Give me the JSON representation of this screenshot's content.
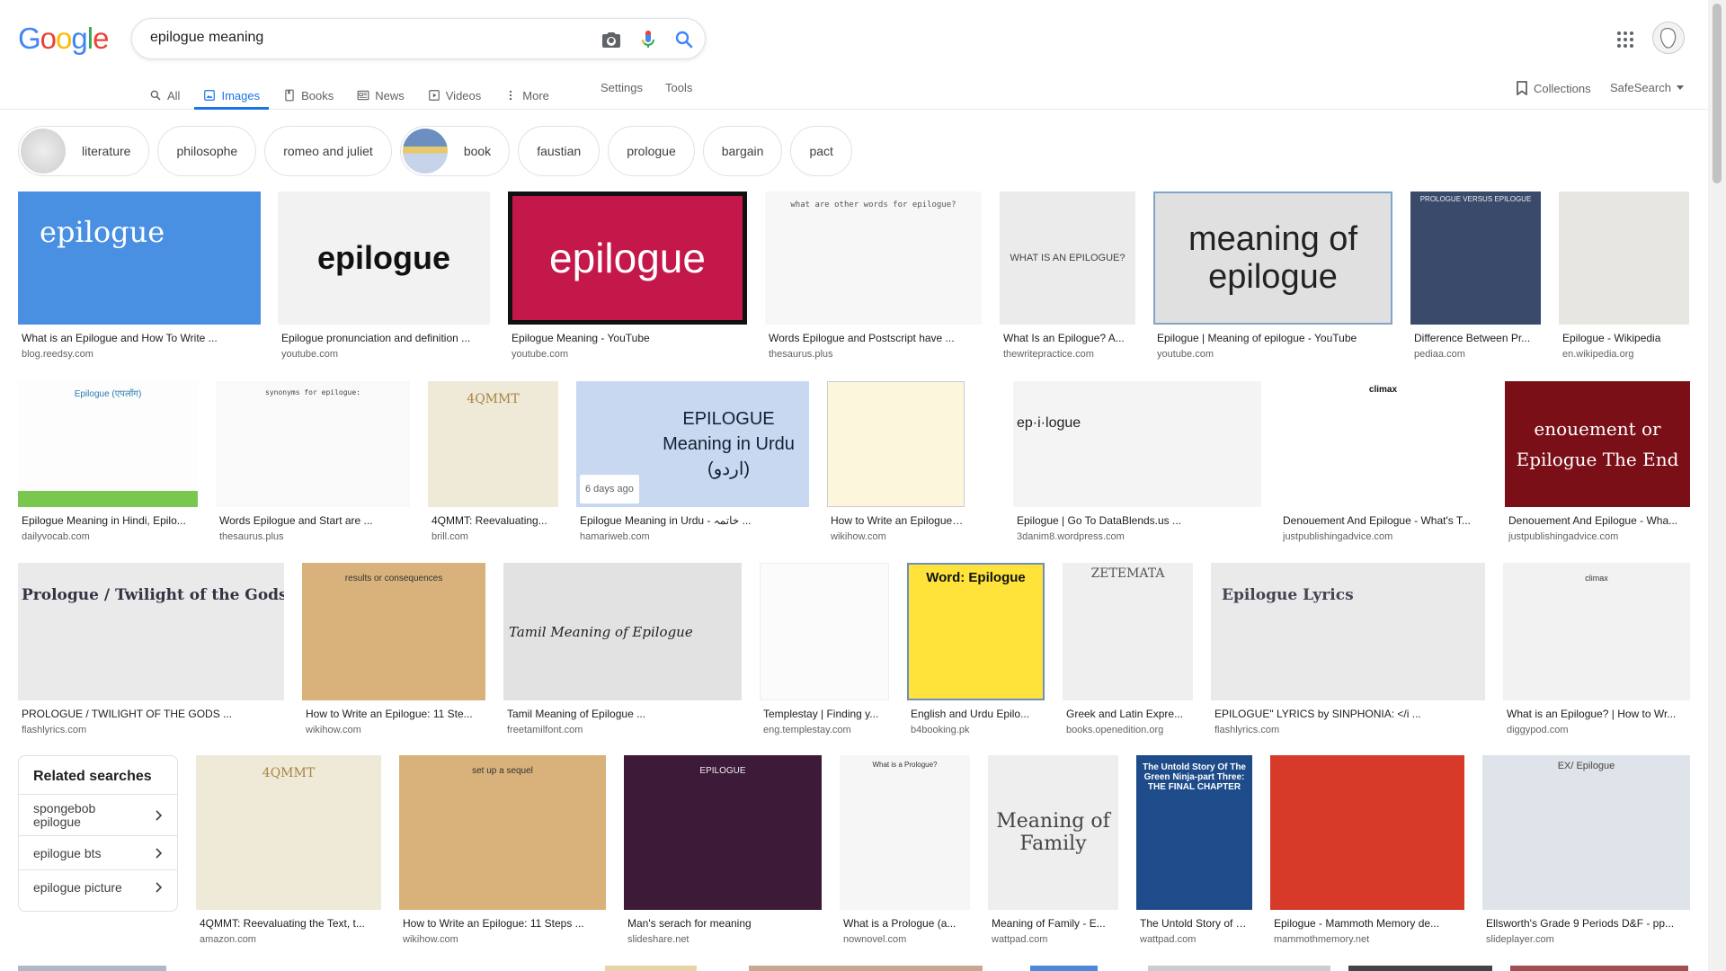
{
  "logo": "Google",
  "search": {
    "query": "epilogue meaning"
  },
  "tabs": [
    {
      "label": "All",
      "icon": "search-icon"
    },
    {
      "label": "Images",
      "icon": "image-icon"
    },
    {
      "label": "Books",
      "icon": "book-icon"
    },
    {
      "label": "News",
      "icon": "news-icon"
    },
    {
      "label": "Videos",
      "icon": "video-icon"
    },
    {
      "label": "More",
      "icon": "more-vert-icon"
    }
  ],
  "settings_label": "Settings",
  "tools_label": "Tools",
  "collections_label": "Collections",
  "safesearch_label": "SafeSearch",
  "chips": [
    "literature",
    "philosophe",
    "romeo and juliet",
    "book",
    "faustian",
    "prologue",
    "bargain",
    "pact"
  ],
  "results": [
    {
      "caption": "What is an Epilogue and How To Write ...",
      "domain": "blog.reedsy.com",
      "img_text": "epilogue"
    },
    {
      "caption": "Epilogue pronunciation and definition ...",
      "domain": "youtube.com",
      "img_text": "epilogue"
    },
    {
      "caption": "Epilogue Meaning - YouTube",
      "domain": "youtube.com",
      "img_text": "epilogue"
    },
    {
      "caption": "Words Epilogue and Postscript have ...",
      "domain": "thesaurus.plus",
      "img_text": "what are other words for epilogue?"
    },
    {
      "caption": "What Is an Epilogue? A...",
      "domain": "thewritepractice.com",
      "img_text": "WHAT IS AN EPILOGUE?"
    },
    {
      "caption": "Epilogue | Meaning of epilogue - YouTube",
      "domain": "youtube.com",
      "img_text": "meaning of epilogue"
    },
    {
      "caption": "Difference Between Pr...",
      "domain": "pediaa.com",
      "img_text": "PROLOGUE VERSUS EPILOGUE"
    },
    {
      "caption": "Epilogue - Wikipedia",
      "domain": "en.wikipedia.org",
      "img_text": ""
    },
    {
      "caption": "Epilogue Meaning in Hindi, Epilo...",
      "domain": "dailyvocab.com",
      "img_text": "Epilogue (एपलॉग)"
    },
    {
      "caption": "Words Epilogue and Start are ...",
      "domain": "thesaurus.plus",
      "img_text": "synonyms for epilogue:"
    },
    {
      "caption": "4QMMT: Reevaluating...",
      "domain": "brill.com",
      "img_text": "4QMMT"
    },
    {
      "caption": "Epilogue Meaning in Urdu - خاتمہ ...",
      "domain": "hamariweb.com",
      "img_text": "EPILOGUE Meaning in Urdu (اردو)",
      "badge": "6 days ago"
    },
    {
      "caption": "How to Write an Epilogue: 11 ...",
      "domain": "wikihow.com",
      "img_text": ""
    },
    {
      "caption": "Epilogue | Go To DataBlends.us ...",
      "domain": "3danim8.wordpress.com",
      "img_text": "ep·i·logue"
    },
    {
      "caption": "Denouement And Epilogue - What's T...",
      "domain": "justpublishingadvice.com",
      "img_text": "climax"
    },
    {
      "caption": "Denouement And Epilogue - Wha...",
      "domain": "justpublishingadvice.com",
      "img_text": "enouement or Epilogue The End"
    },
    {
      "caption": "PROLOGUE / TWILIGHT OF THE GODS ...",
      "domain": "flashlyrics.com",
      "img_text": "Prologue / Twilight of the Gods / Epil"
    },
    {
      "caption": "How to Write an Epilogue: 11 Ste...",
      "domain": "wikihow.com",
      "img_text": "results or consequences"
    },
    {
      "caption": "Tamil Meaning of Epilogue ...",
      "domain": "freetamilfont.com",
      "img_text": "Tamil Meaning of Epilogue"
    },
    {
      "caption": "Templestay | Finding y...",
      "domain": "eng.templestay.com",
      "img_text": ""
    },
    {
      "caption": "English and Urdu Epilo...",
      "domain": "b4booking.pk",
      "img_text": "Word: Epilogue"
    },
    {
      "caption": "Greek and Latin Expre...",
      "domain": "books.openedition.org",
      "img_text": "ZETEMATA"
    },
    {
      "caption": "EPILOGUE\" LYRICS by SINPHONIA: </i ...",
      "domain": "flashlyrics.com",
      "img_text": "Epilogue Lyrics"
    },
    {
      "caption": "What is an Epilogue? | How to Wr...",
      "domain": "diggypod.com",
      "img_text": "climax"
    },
    {
      "caption": "4QMMT: Reevaluating the Text, t...",
      "domain": "amazon.com",
      "img_text": "4QMMT"
    },
    {
      "caption": "How to Write an Epilogue: 11 Steps ...",
      "domain": "wikihow.com",
      "img_text": "set up a sequel"
    },
    {
      "caption": "Man's serach for meaning",
      "domain": "slideshare.net",
      "img_text": "EPILOGUE"
    },
    {
      "caption": "What is a Prologue (a...",
      "domain": "nownovel.com",
      "img_text": "What is a Prologue?"
    },
    {
      "caption": "Meaning of Family - E...",
      "domain": "wattpad.com",
      "img_text": "Meaning of Family"
    },
    {
      "caption": "The Untold Story of Th...",
      "domain": "wattpad.com",
      "img_text": "The Untold Story Of The Green Ninja-part Three: THE FINAL CHAPTER"
    },
    {
      "caption": "Epilogue - Mammoth Memory de...",
      "domain": "mammothmemory.net",
      "img_text": ""
    },
    {
      "caption": "Ellsworth's Grade 9 Periods D&F - pp...",
      "domain": "slideplayer.com",
      "img_text": "EX/ Epilogue"
    }
  ],
  "related": {
    "title": "Related searches",
    "items": [
      "spongebob epilogue",
      "epilogue bts",
      "epilogue picture"
    ]
  }
}
